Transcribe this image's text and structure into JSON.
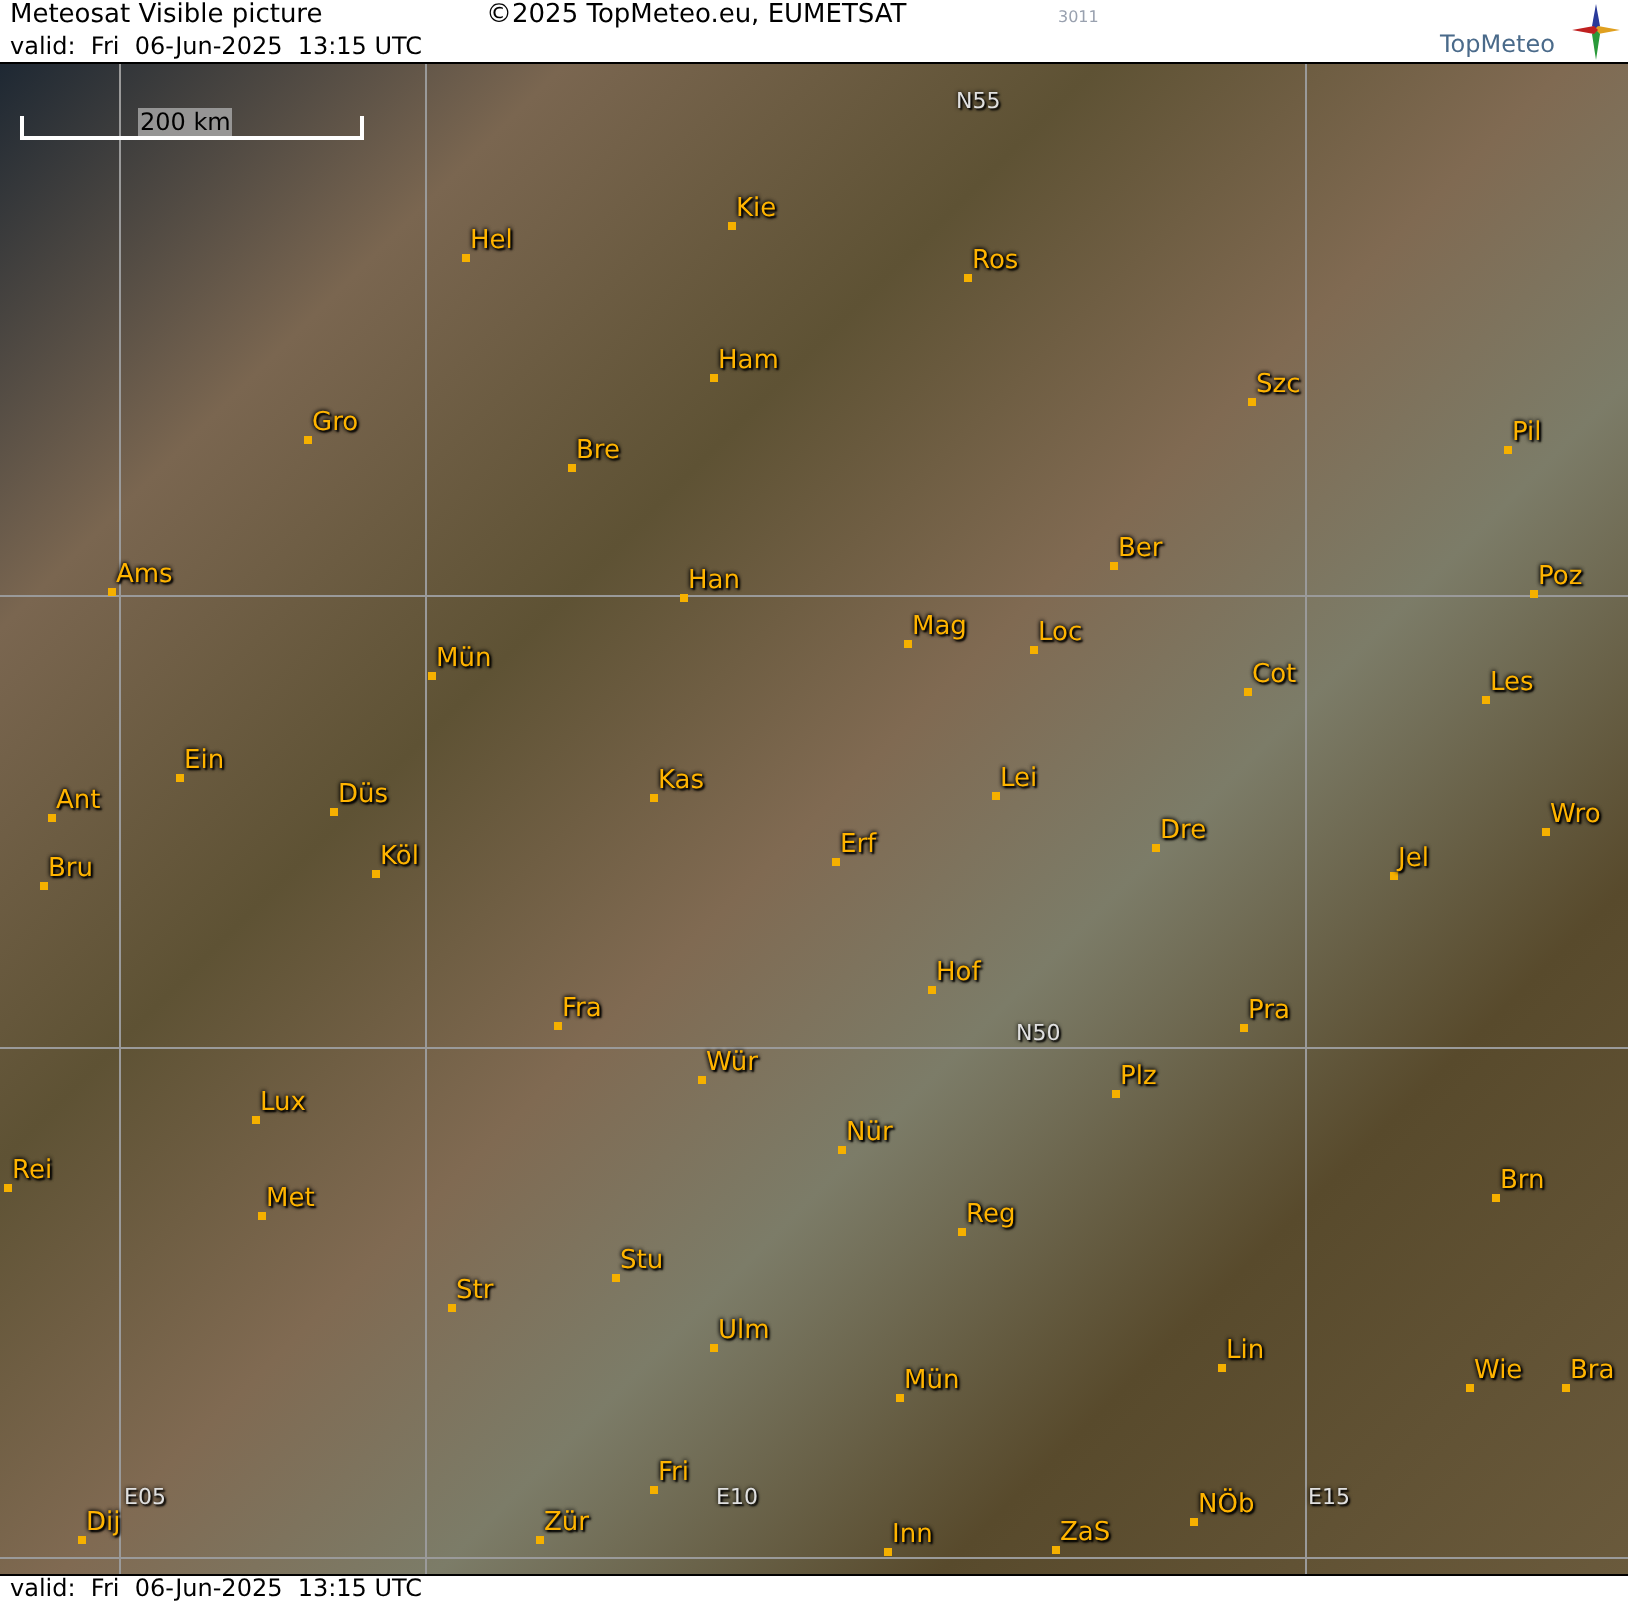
{
  "header": {
    "title": "Meteosat Visible picture",
    "copyright": "©2025 TopMeteo.eu, EUMETSAT",
    "code": "3011",
    "valid": "valid:  Fri  06-Jun-2025  13:15 UTC",
    "logo": "TopMeteo"
  },
  "map": {
    "scale": "200 km",
    "grid_labels": [
      "N55",
      "N50",
      "E05",
      "E10",
      "E15"
    ],
    "cities": [
      "Kie",
      "Hel",
      "Ros",
      "Ham",
      "Szc",
      "Gro",
      "Bre",
      "Pil",
      "Ams",
      "Han",
      "Ber",
      "Poz",
      "Mün",
      "Mag",
      "Loc",
      "Cot",
      "Les",
      "Ant",
      "Ein",
      "Düs",
      "Kas",
      "Lei",
      "Dre",
      "Wro",
      "Bru",
      "Köl",
      "Erf",
      "Jel",
      "Hof",
      "Fra",
      "Pra",
      "Wür",
      "Lux",
      "Plz",
      "Nür",
      "Rei",
      "Met",
      "Reg",
      "Brn",
      "Stu",
      "Str",
      "Ulm",
      "Mün",
      "Lin",
      "Wie",
      "Bra",
      "Fri",
      "Dij",
      "Zür",
      "Inn",
      "ZaS",
      "NÖb"
    ]
  },
  "footer": {
    "valid": "valid:  Fri  06-Jun-2025  13:15 UTC"
  }
}
